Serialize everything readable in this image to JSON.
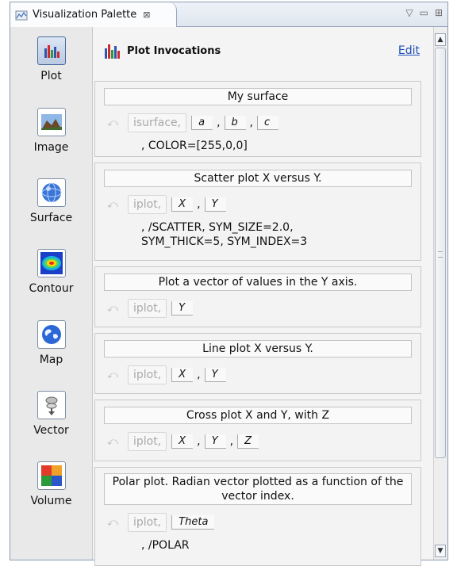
{
  "window": {
    "tab_title": "Visualization Palette",
    "tab_close": "⊠",
    "controls": [
      "▽",
      "▭",
      "⊞"
    ]
  },
  "sidebar": {
    "items": [
      {
        "label": "Plot",
        "icon": "plot-icon",
        "active": true
      },
      {
        "label": "Image",
        "icon": "image-icon"
      },
      {
        "label": "Surface",
        "icon": "surface-icon"
      },
      {
        "label": "Contour",
        "icon": "contour-icon"
      },
      {
        "label": "Map",
        "icon": "map-icon"
      },
      {
        "label": "Vector",
        "icon": "vector-icon"
      },
      {
        "label": "Volume",
        "icon": "volume-icon"
      }
    ]
  },
  "main": {
    "header_title": "Plot Invocations",
    "edit_link": "Edit",
    "cards": [
      {
        "title": "My surface",
        "fn": "isurface,",
        "args": [
          "a",
          "b",
          "c"
        ],
        "extra": ", COLOR=[255,0,0]"
      },
      {
        "title": "Scatter plot X versus Y.",
        "fn": "iplot,",
        "args": [
          "X",
          "Y"
        ],
        "extra": ", /SCATTER, SYM_SIZE=2.0,\nSYM_THICK=5, SYM_INDEX=3"
      },
      {
        "title": "Plot a vector of values in the Y axis.",
        "fn": "iplot,",
        "args": [
          "Y"
        ],
        "extra": ""
      },
      {
        "title": "Line plot X versus Y.",
        "fn": "iplot,",
        "args": [
          "X",
          "Y"
        ],
        "extra": ""
      },
      {
        "title": "Cross plot X and Y, with Z",
        "fn": "iplot,",
        "args": [
          "X",
          "Y",
          "Z"
        ],
        "extra": ""
      },
      {
        "title": "Polar plot. Radian vector plotted as a function of the vector index.",
        "fn": "iplot,",
        "args": [
          "Theta"
        ],
        "extra": ", /POLAR"
      }
    ]
  },
  "colors": {
    "link": "#1f4fb8",
    "panel_border": "#8a9db3"
  }
}
